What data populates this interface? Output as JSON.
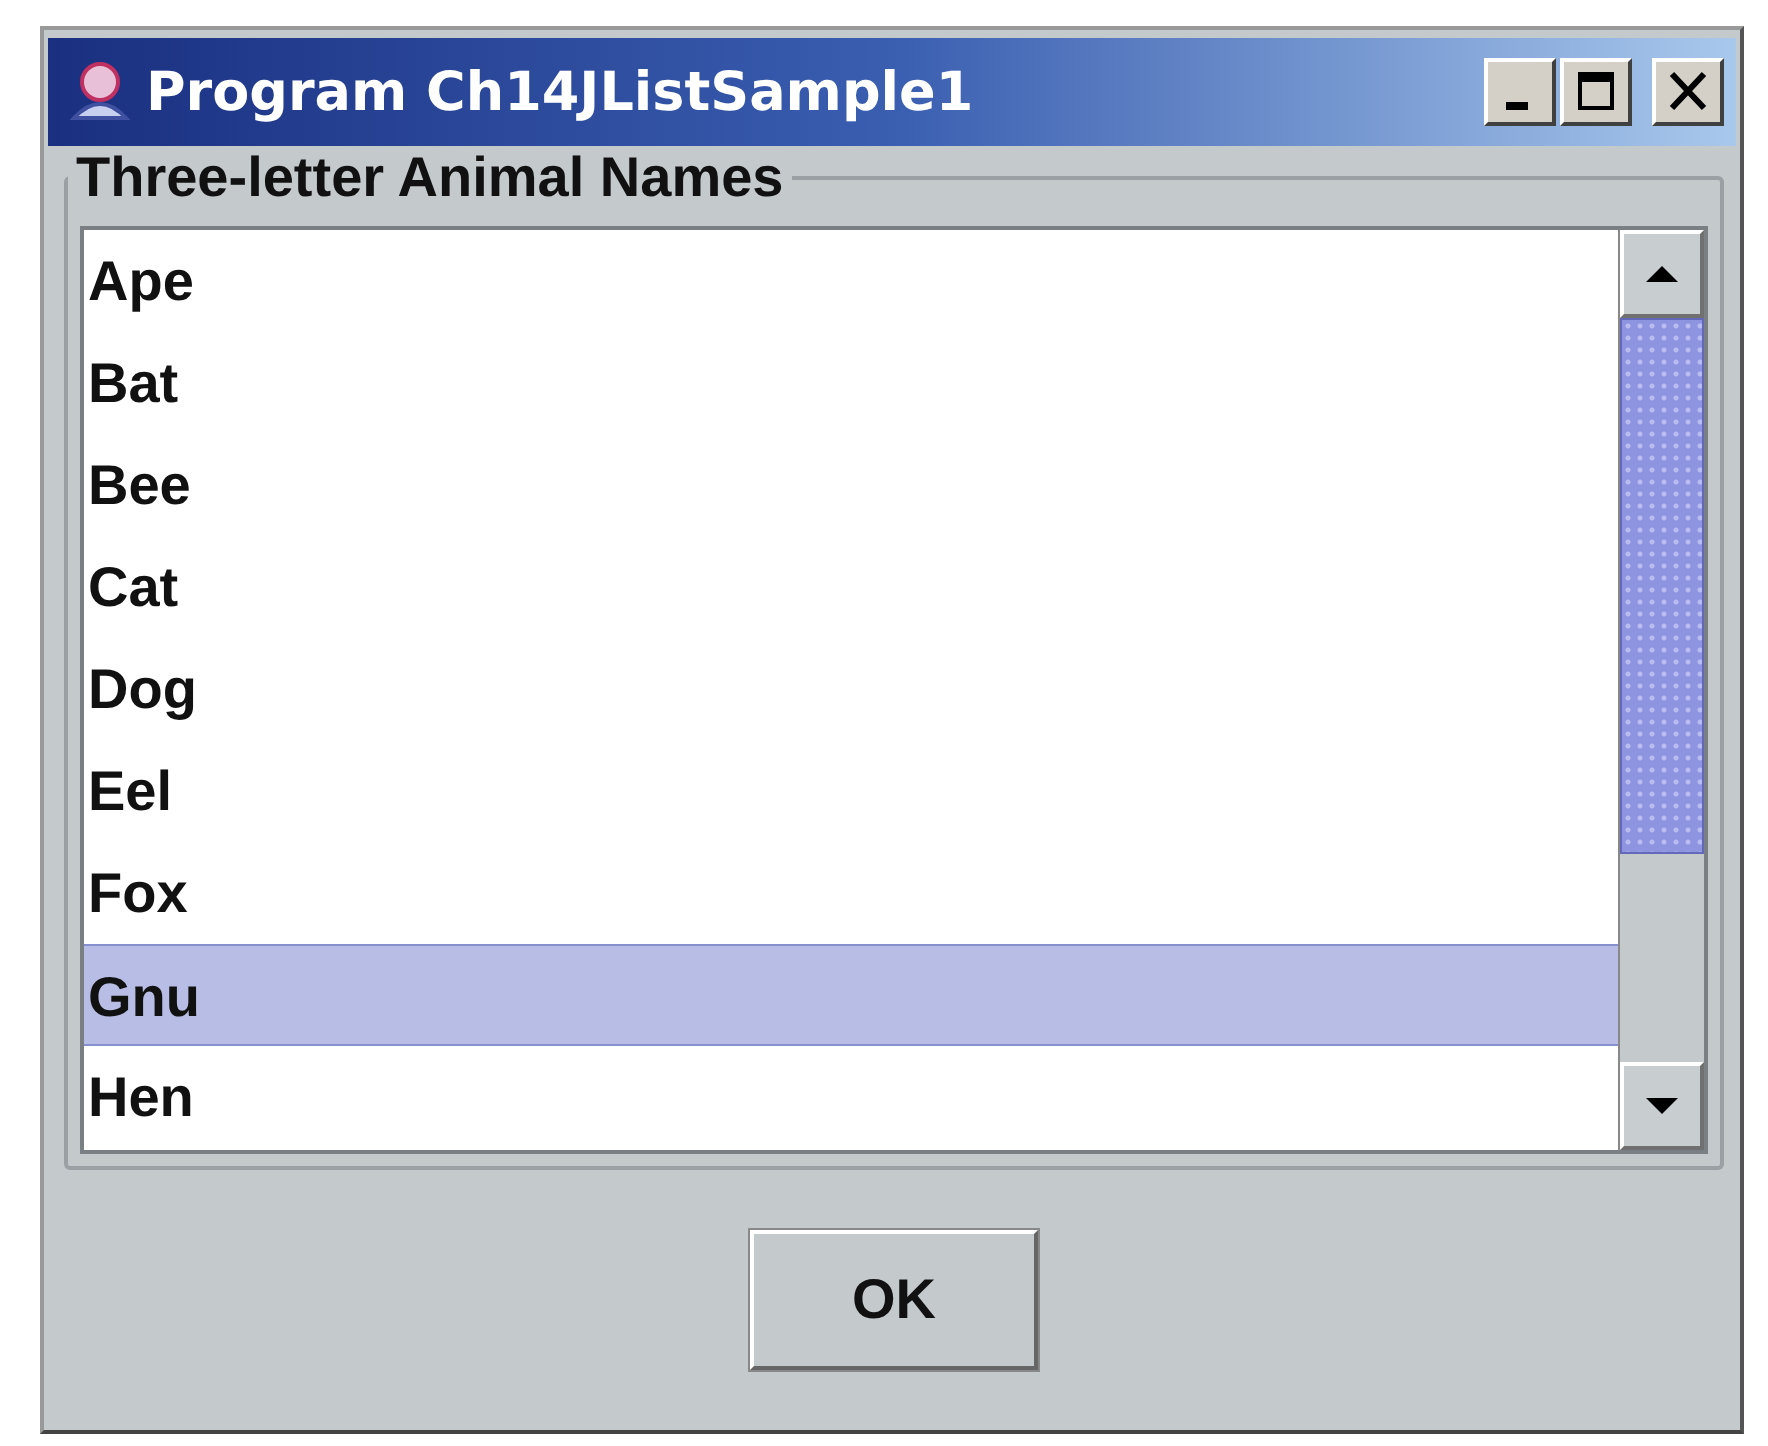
{
  "window": {
    "title": "Program Ch14JListSample1"
  },
  "group": {
    "title": "Three-letter Animal Names"
  },
  "list": {
    "items": [
      {
        "label": "Ape",
        "selected": false
      },
      {
        "label": "Bat",
        "selected": false
      },
      {
        "label": "Bee",
        "selected": false
      },
      {
        "label": "Cat",
        "selected": false
      },
      {
        "label": "Dog",
        "selected": false
      },
      {
        "label": "Eel",
        "selected": false
      },
      {
        "label": "Fox",
        "selected": false
      },
      {
        "label": "Gnu",
        "selected": true
      },
      {
        "label": "Hen",
        "selected": false
      }
    ]
  },
  "buttons": [
    {
      "label": "OK"
    }
  ]
}
